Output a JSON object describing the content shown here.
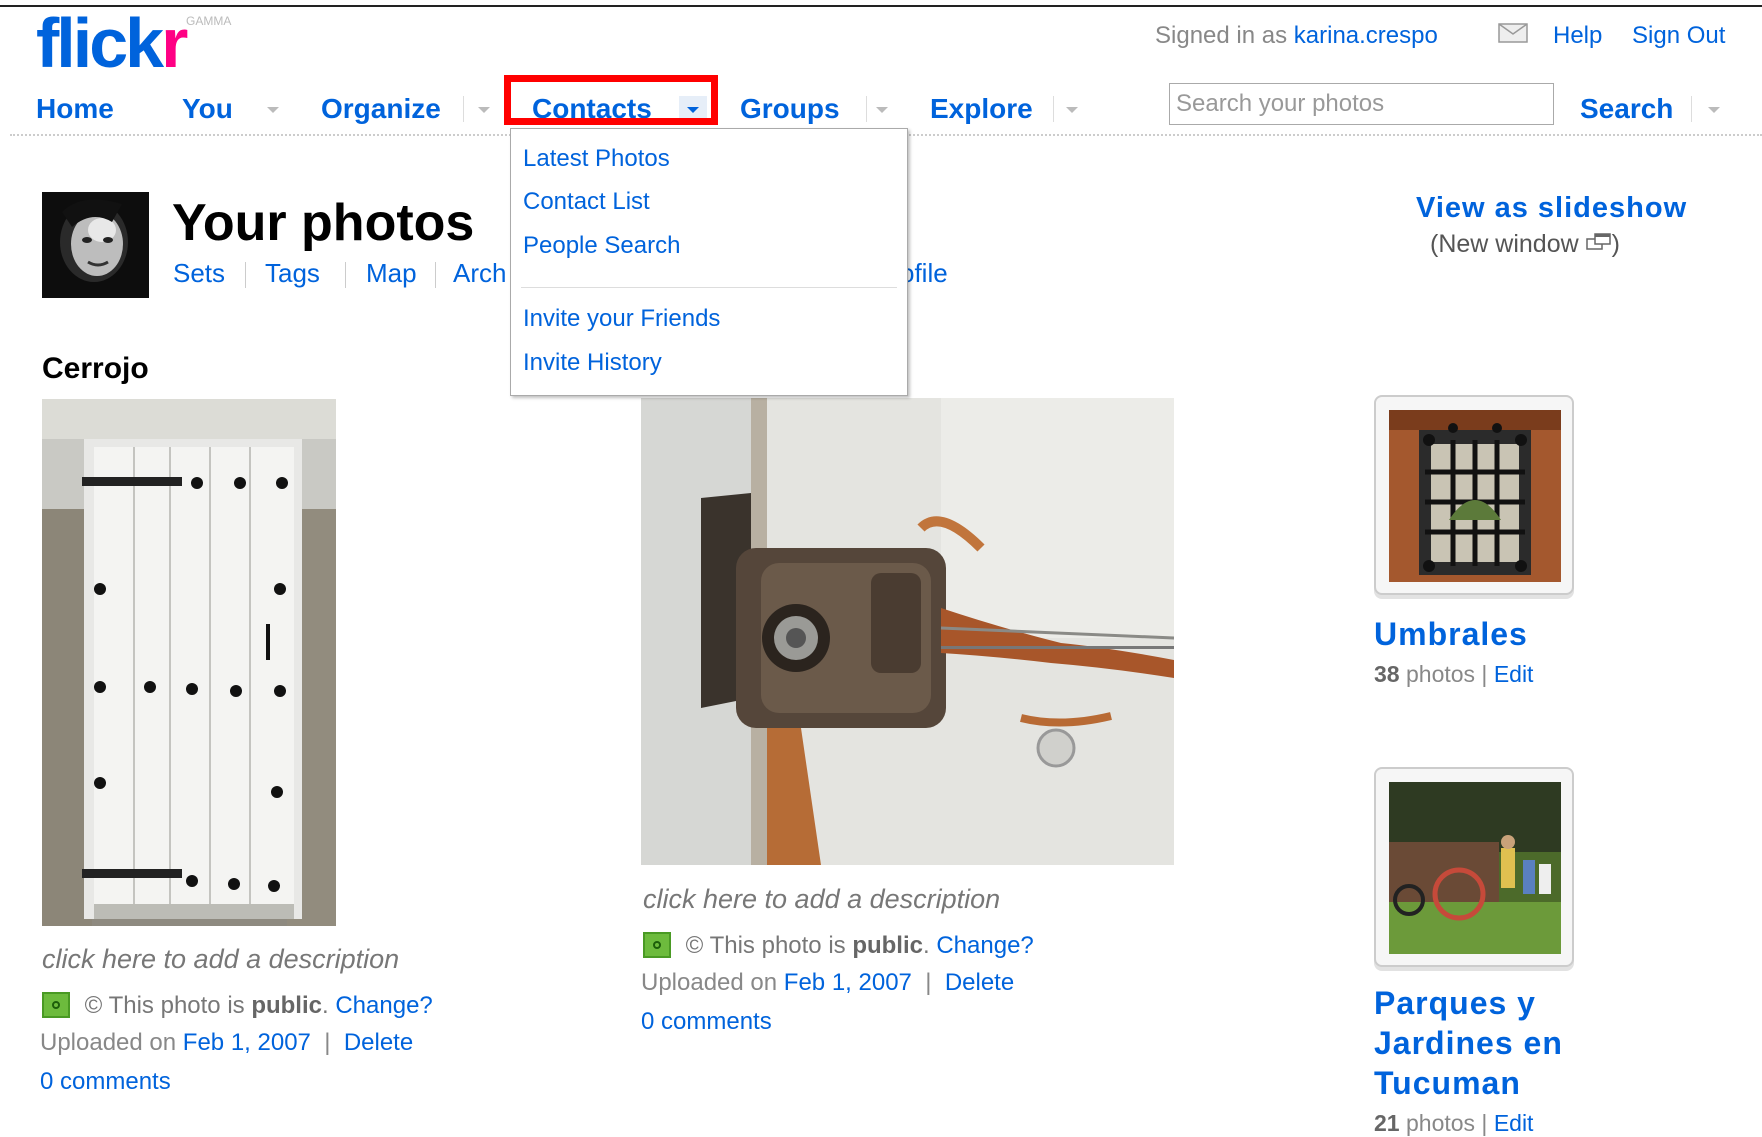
{
  "header": {
    "logo_text": "flickr",
    "logo_badge": "GAMMA",
    "signed_in_prefix": "Signed in as",
    "username": "karina.crespo",
    "help_label": "Help",
    "signout_label": "Sign Out",
    "mail_icon": "envelope-icon"
  },
  "nav": {
    "home": "Home",
    "you": "You",
    "organize": "Organize",
    "contacts": "Contacts",
    "groups": "Groups",
    "explore": "Explore",
    "search_placeholder": "Search your photos",
    "search_label": "Search"
  },
  "contacts_menu": {
    "items": [
      "Latest Photos",
      "Contact List",
      "People Search",
      "Invite your Friends",
      "Invite History"
    ]
  },
  "profile": {
    "title": "Your photos",
    "subnav": [
      "Sets",
      "Tags",
      "Map",
      "Arch",
      "ofile"
    ],
    "slideshow": "View as slideshow",
    "new_window": "(New window ",
    "new_window_close": ")"
  },
  "photos": [
    {
      "title": "Cerrojo",
      "description": "click here to add a description",
      "privacy_prefix": "© This photo is",
      "privacy": "public",
      "change": "Change?",
      "uploaded_prefix": "Uploaded on",
      "date": "Feb 1, 2007",
      "delete": "Delete",
      "comments": "0 comments"
    },
    {
      "title": "",
      "description": "click here to add a description",
      "privacy_prefix": "© This photo is",
      "privacy": "public",
      "change": "Change?",
      "uploaded_prefix": "Uploaded on",
      "date": "Feb 1, 2007",
      "delete": "Delete",
      "comments": "0 comments"
    }
  ],
  "sets": [
    {
      "title": "Umbrales",
      "count": "38",
      "photos_label": "photos",
      "edit": "Edit"
    },
    {
      "title": "Parques y Jardines en Tucuman",
      "count": "21",
      "photos_label": "photos",
      "edit": "Edit"
    }
  ],
  "colors": {
    "link": "#0063dc",
    "brand_pink": "#ff0084",
    "highlight": "#ff0000"
  }
}
